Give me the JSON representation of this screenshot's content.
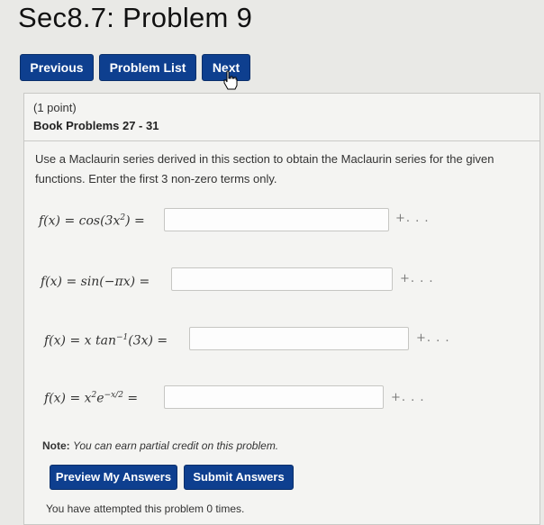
{
  "page": {
    "title": "Sec8.7: Problem 9"
  },
  "nav": {
    "previous": "Previous",
    "problem_list": "Problem List",
    "next": "Next"
  },
  "problem": {
    "points": "(1 point)",
    "book": "Book Problems 27 - 31",
    "description": "Use a Maclaurin series derived in this section to obtain the Maclaurin series for the given functions. Enter the first 3 non-zero terms only.",
    "continuation": "+. . .",
    "equations": [
      {
        "lhs": "f(x) = cos(3x",
        "sup": "2",
        "rhs": ") ="
      },
      {
        "lhs": "f(x) = sin(−πx) =",
        "sup": "",
        "rhs": ""
      },
      {
        "lhs": "f(x) = x tan",
        "sup": "−1",
        "rhs": "(3x) ="
      },
      {
        "lhs": "f(x) = x",
        "sup": "2",
        "mid": "e",
        "sup2": "−x/2",
        "rhs": " ="
      }
    ]
  },
  "note": {
    "label": "Note:",
    "text": "You can earn partial credit on this problem."
  },
  "actions": {
    "preview": "Preview My Answers",
    "submit": "Submit Answers"
  },
  "status": {
    "attempts": "You have attempted this problem 0 times."
  },
  "colors": {
    "button": "#0e3f8f",
    "panel": "#f4f4f2",
    "background": "#e9e9e6"
  },
  "icons": {
    "cursor": "hand-pointer-icon"
  }
}
